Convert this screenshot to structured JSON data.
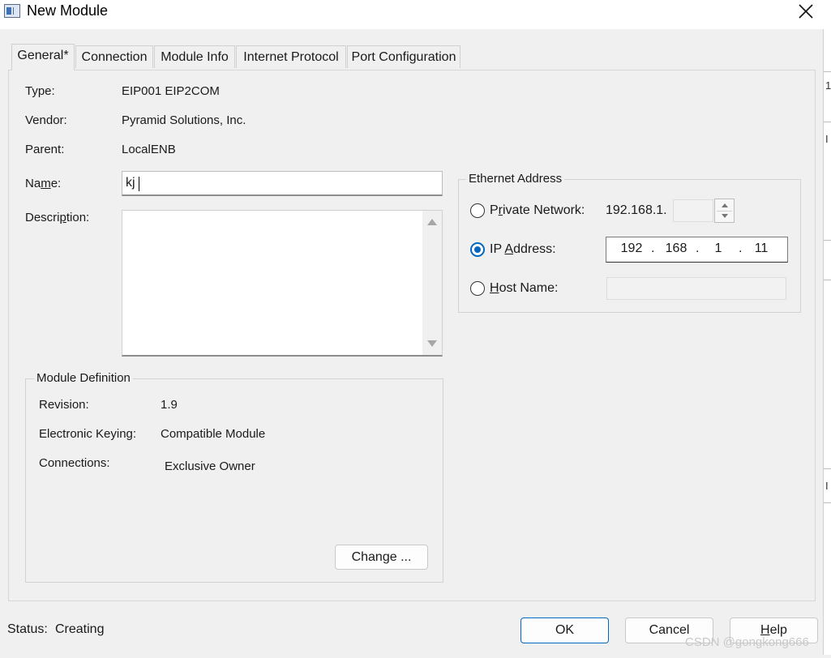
{
  "window": {
    "title": "New Module"
  },
  "tabs": [
    {
      "label": "General*"
    },
    {
      "label": "Connection"
    },
    {
      "label": "Module Info"
    },
    {
      "label": "Internet Protocol"
    },
    {
      "label": "Port Configuration"
    }
  ],
  "general": {
    "type_label": "Type:",
    "type_value": "EIP001 EIP2COM",
    "vendor_label": "Vendor:",
    "vendor_value": "Pyramid Solutions, Inc.",
    "parent_label": "Parent:",
    "parent_value": "LocalENB",
    "name_label_pre": "Na",
    "name_label_u": "m",
    "name_label_post": "e:",
    "name_value": "kj",
    "description_label_pre": "Descri",
    "description_label_u": "p",
    "description_label_post": "tion:",
    "description_value": ""
  },
  "module_definition": {
    "title": "Module Definition",
    "revision_label": "Revision:",
    "revision_value": "1.9",
    "keying_label": "Electronic Keying:",
    "keying_value": "Compatible Module",
    "connections_label": "Connections:",
    "connections_value": "Exclusive Owner",
    "change_button": "Change ..."
  },
  "ethernet": {
    "title": "Ethernet Address",
    "private_label_pre": "P",
    "private_label_u": "r",
    "private_label_post": "ivate Network:",
    "private_prefix": "192.168.1.",
    "private_last_octet": "",
    "ip_label_pre": "IP ",
    "ip_label_u": "A",
    "ip_label_post": "ddress:",
    "ip_octets": [
      "192",
      "168",
      "1",
      "11"
    ],
    "ip_dot": ".",
    "host_label_u": "H",
    "host_label_post": "ost Name:",
    "host_value": "",
    "selected": "ip_address"
  },
  "footer": {
    "status_label": "Status:",
    "status_value": "Creating",
    "ok": "OK",
    "cancel": "Cancel",
    "help_u": "H",
    "help_post": "elp"
  },
  "watermark": "CSDN @gongkong666",
  "behind_window": {
    "chars": [
      "1",
      "I",
      "I"
    ]
  }
}
